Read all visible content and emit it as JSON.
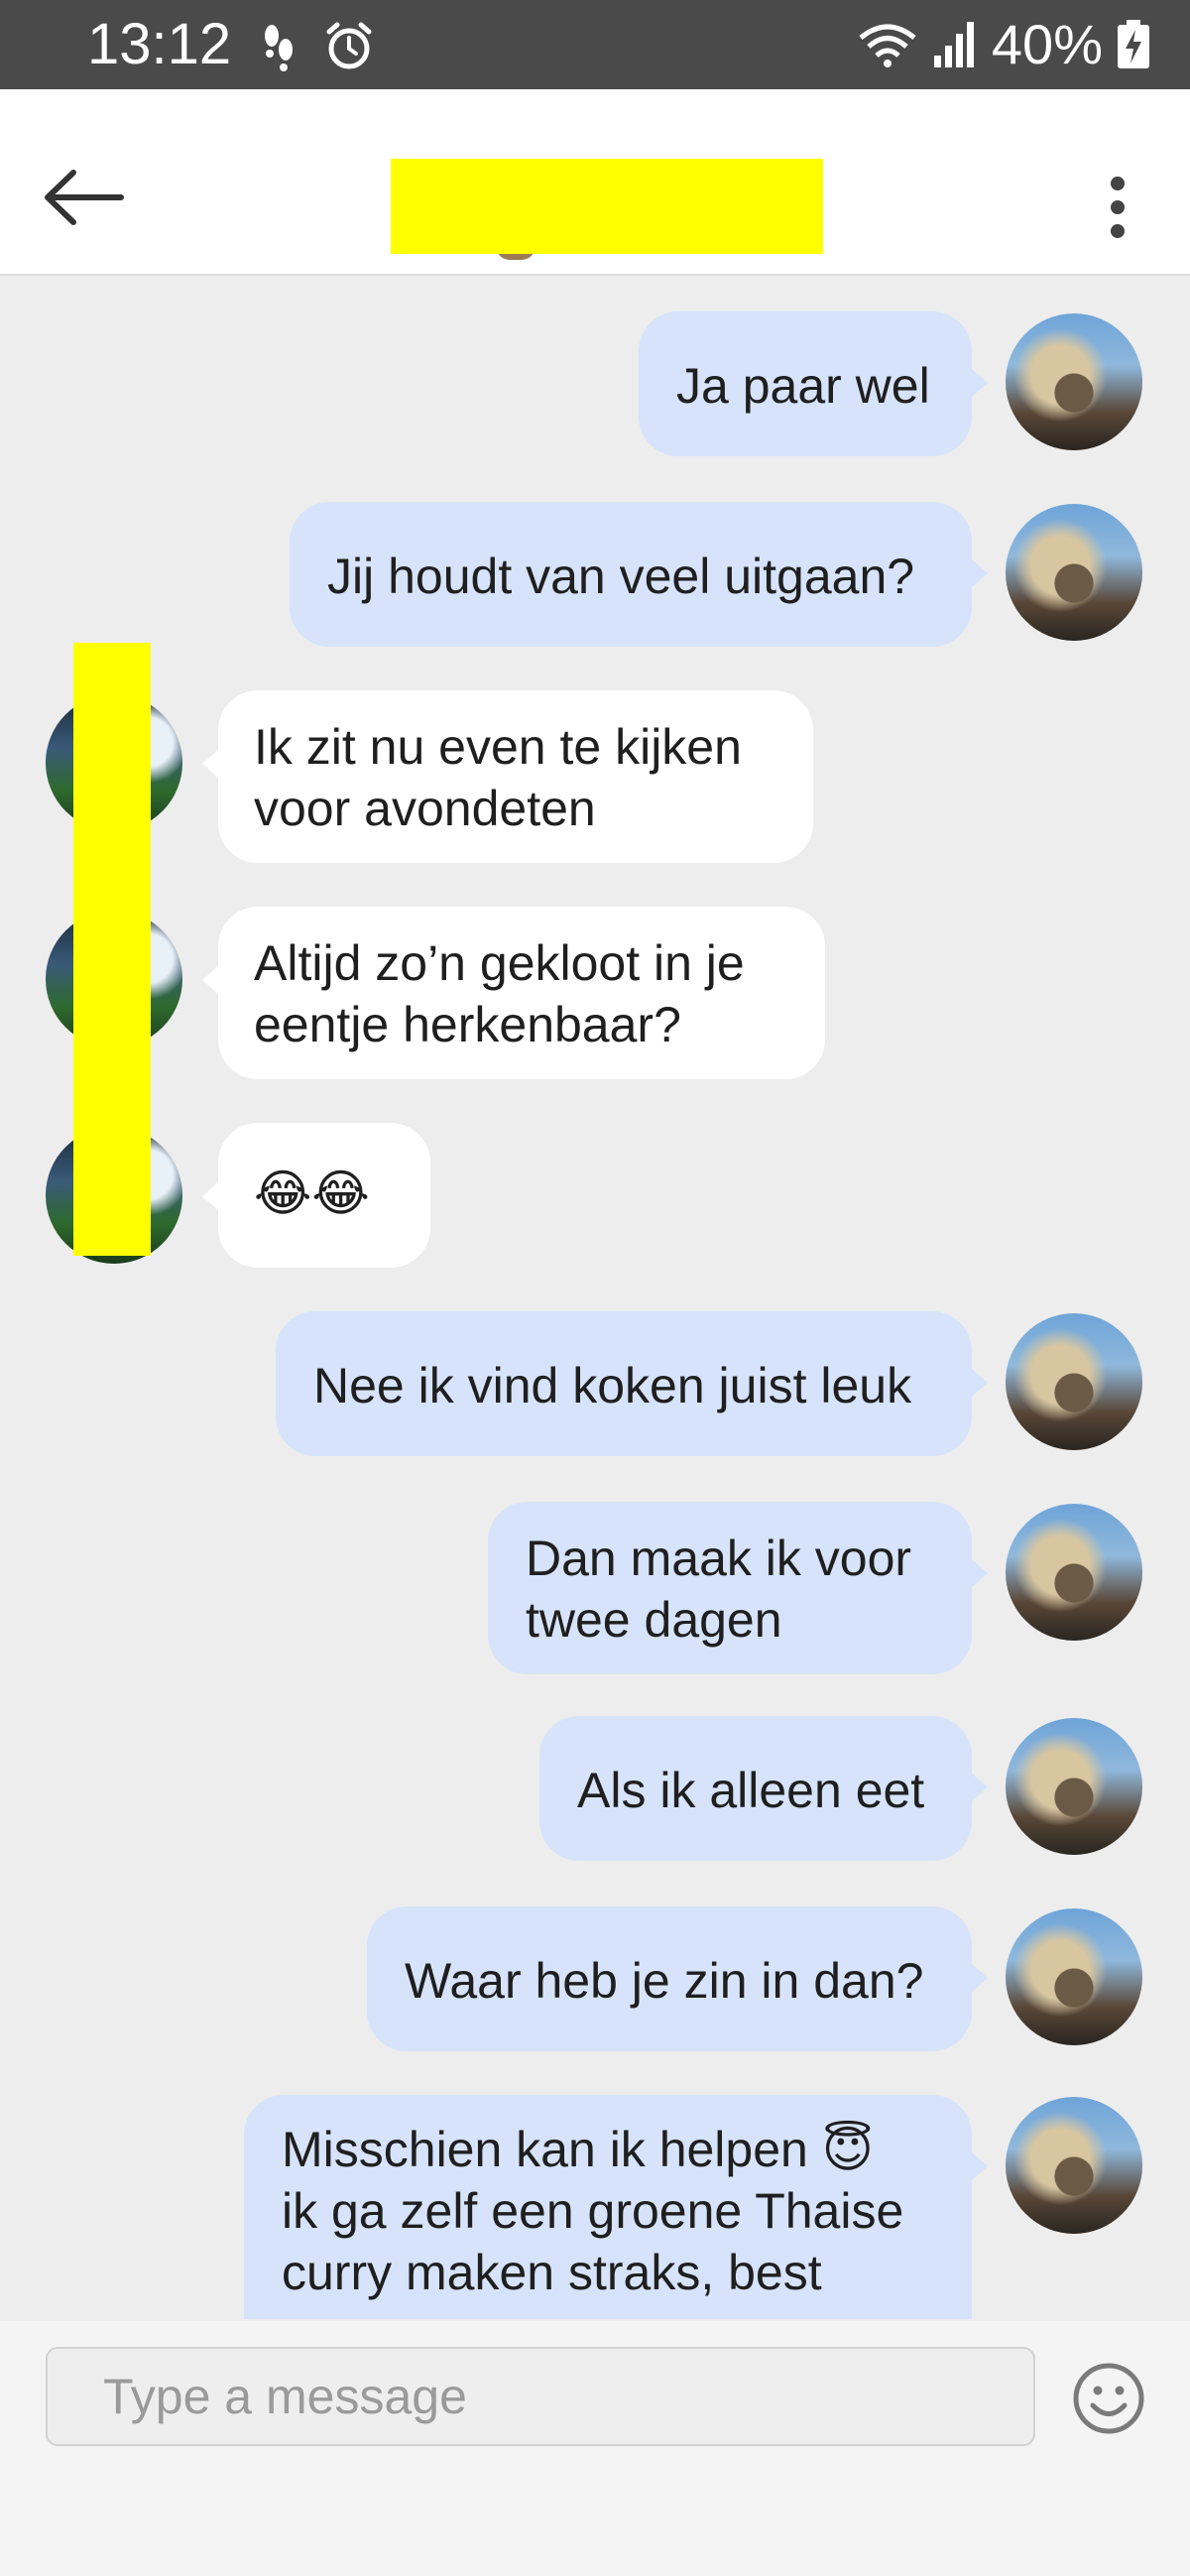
{
  "status_bar": {
    "time": "13:12",
    "battery": "40%",
    "icons": [
      "footsteps-icon",
      "alarm-icon",
      "wifi-icon",
      "signal-icon",
      "battery-charging-icon"
    ]
  },
  "header": {
    "back_icon": "arrow-left-icon",
    "menu_icon": "more-vertical-icon"
  },
  "messages": [
    {
      "from": "me",
      "text": "Ja paar wel"
    },
    {
      "from": "me",
      "text": "Jij houdt van veel uitgaan?"
    },
    {
      "from": "them",
      "text": "Ik zit nu even te kijken\nvoor avondeten"
    },
    {
      "from": "them",
      "text": "Altijd zo’n gekloot in je\neentje herkenbaar?"
    },
    {
      "from": "them",
      "text": "😂😂"
    },
    {
      "from": "me",
      "text": "Nee ik vind koken juist leuk"
    },
    {
      "from": "me",
      "text": "Dan maak ik voor\ntwee dagen"
    },
    {
      "from": "me",
      "text": "Als ik alleen eet"
    },
    {
      "from": "me",
      "text": "Waar heb je zin in dan?"
    },
    {
      "from": "me",
      "text": "Misschien kan ik helpen 😇\nik ga zelf een groene Thaise\ncurry maken straks, best"
    }
  ],
  "composer": {
    "placeholder": "Type a message",
    "emoji_icon": "smiley-icon"
  },
  "colors": {
    "status_bar": "#4a4a4a",
    "background": "#ededed",
    "outgoing_bubble": "#d6e3fb",
    "incoming_bubble": "#ffffff",
    "redaction": "#ffff00"
  }
}
